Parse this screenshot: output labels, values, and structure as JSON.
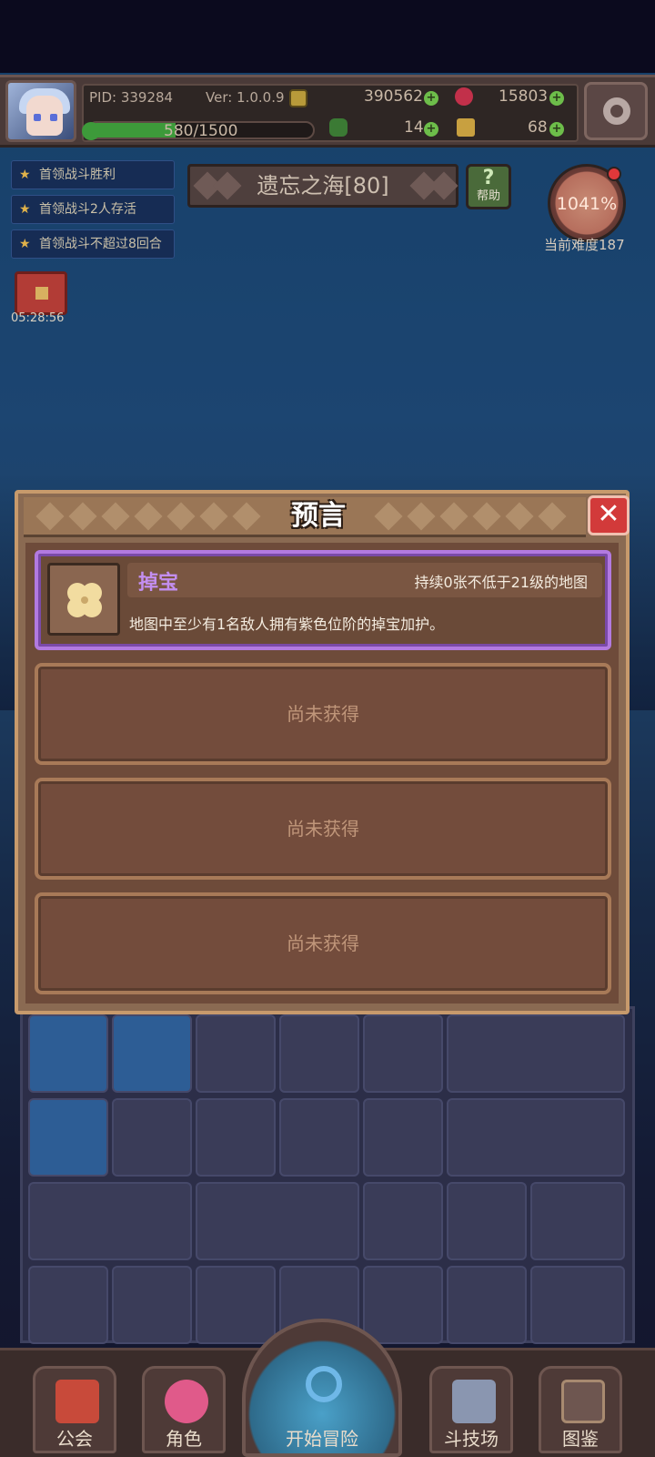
{
  "player": {
    "pid": "PID: 339284",
    "version": "Ver: 1.0.0.9",
    "gold": "390562",
    "gems": "15803",
    "clover": "14",
    "keys": "68",
    "xp": "580/1500",
    "xp_fraction": 0.387
  },
  "quests": [
    {
      "label": "首领战斗胜利"
    },
    {
      "label": "首领战斗2人存活"
    },
    {
      "label": "首领战斗不超过8回合"
    }
  ],
  "chest_timer": "05:28:56",
  "stage": {
    "title": "遗忘之海[80]"
  },
  "help": {
    "label": "帮助"
  },
  "difficulty": {
    "percent": "1041%",
    "label": "当前难度187"
  },
  "dialog": {
    "title": "预言",
    "prophecy": {
      "name": "掉宝",
      "condition": "持续0张不低于21级的地图",
      "description": "地图中至少有1名敌人拥有紫色位阶的掉宝加护。",
      "icon": "clover-icon"
    },
    "slots": [
      {
        "label": "尚未获得"
      },
      {
        "label": "尚未获得"
      },
      {
        "label": "尚未获得"
      }
    ]
  },
  "nav": {
    "guild": "公会",
    "character": "角色",
    "start": "开始冒险",
    "arena": "斗技场",
    "codex": "图鉴"
  },
  "colors": {
    "accent_purple": "#c38ef0",
    "close_red": "#d23a3a",
    "panel_brown": "#6e4b3a"
  }
}
